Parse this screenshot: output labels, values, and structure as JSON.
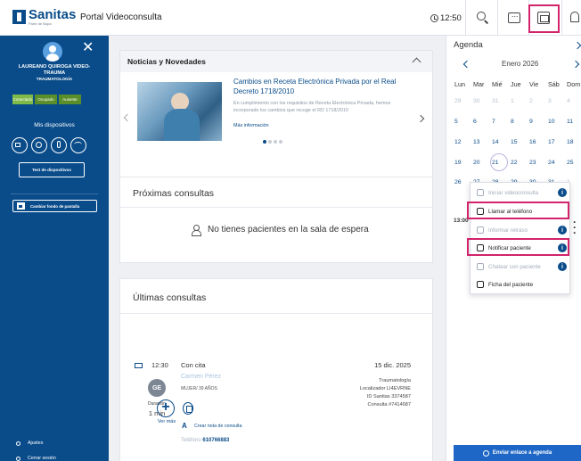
{
  "header": {
    "logo_text": "Sanitas",
    "logo_sub": "Parte de Bupa",
    "portal_title": "Portal Videoconsulta",
    "time": "12:50"
  },
  "sidebar": {
    "doctor_name": "LAUREANO QUIROGA VIDEO-TRAUMA",
    "specialty": "TRAUMATOLOGÍA",
    "status": {
      "connected": "Conectado",
      "busy": "Ocupado",
      "away": "Ausente"
    },
    "devices_title": "Mis dispositivos",
    "test_button": "Test de dispositivos",
    "background_button": "Cambiar fondo de pantalla",
    "settings": "Ajustes",
    "logout": "Cerrar sesión"
  },
  "news": {
    "title": "Noticias y Novedades",
    "item_title": "Cambios en Receta Electrónica Privada por el Real Decreto 1718/2010",
    "item_body": "En cumplimiento con los requisitos de Receta Electrónica Privada, hemos incorporado los cambios que recoge el RD 1718/2010",
    "more_link": "Más información"
  },
  "next_consultations": {
    "title": "Próximas consultas",
    "empty_message": "No tienes pacientes en la sala de espera"
  },
  "last_consultations": {
    "title": "Últimas consultas",
    "item": {
      "time": "12:30",
      "type": "Con cita",
      "patient_name": "Carmen Pérez",
      "patient_meta": "MUJER/ 39 AÑOS",
      "initials": "GE",
      "duration_label": "Duración",
      "duration_value": "1 min",
      "note_link": "Crear nota de consulta",
      "phone_label": "Teléfono",
      "phone_value": "610766883",
      "date": "15 dic. 2025",
      "specialty": "Traumatología",
      "locator": "Localizador LI4EVRNE",
      "sanitas_id": "ID Sanitas 3374587",
      "consultation_id": "Consulta #7414687"
    },
    "see_more": "Ver más"
  },
  "agenda": {
    "title": "Agenda",
    "month": "Enero 2026",
    "weekdays": [
      "Lun",
      "Mar",
      "Mié",
      "Jue",
      "Vie",
      "Sáb",
      "Dom"
    ],
    "rows": [
      [
        "29",
        "30",
        "31",
        "1",
        "2",
        "3",
        "4"
      ],
      [
        "5",
        "6",
        "7",
        "8",
        "9",
        "10",
        "11"
      ],
      [
        "12",
        "13",
        "14",
        "15",
        "16",
        "17",
        "18"
      ],
      [
        "19",
        "20",
        "21",
        "22",
        "23",
        "24",
        "25"
      ],
      [
        "26",
        "27",
        "28",
        "29",
        "30",
        "31",
        "1"
      ]
    ],
    "appointment_time": "13:00",
    "send_link": "Enviar enlace a agenda"
  },
  "dropdown": {
    "items": [
      "Iniciar videoconsulta",
      "Llamar al teléfono",
      "Informar retraso",
      "Notificar paciente",
      "Chatear con paciente",
      "Ficha del paciente"
    ]
  },
  "colors": {
    "brand": "#0a4c8a",
    "highlight": "#d2236b",
    "status_active": "#7fb94a",
    "cta": "#1f67c6"
  }
}
